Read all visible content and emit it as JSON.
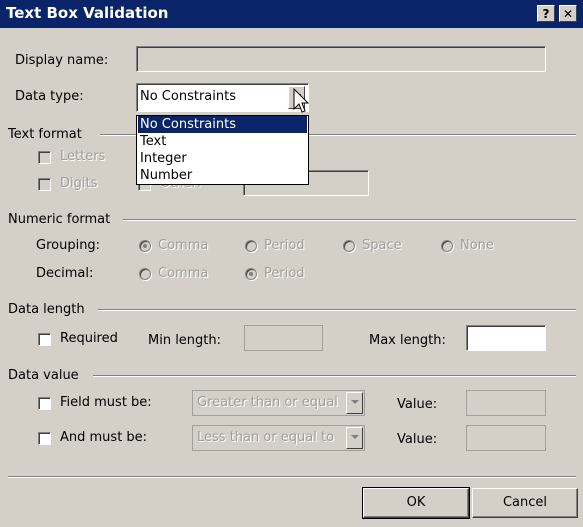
{
  "window": {
    "title": "Text Box Validation",
    "help_button": "?",
    "close_button": "✕",
    "colors": {
      "titlebar": "#0a246a",
      "face": "#d4d0c8",
      "selection": "#0a246a"
    }
  },
  "display_name": {
    "label": "Display name:",
    "value": ""
  },
  "data_type": {
    "label": "Data type:",
    "selected": "No Constraints",
    "options": [
      "No Constraints",
      "Text",
      "Integer",
      "Number"
    ]
  },
  "text_format": {
    "title": "Text format",
    "letters": "Letters",
    "digits": "Digits",
    "other": "Other:"
  },
  "numeric_format": {
    "title": "Numeric format",
    "grouping_label": "Grouping:",
    "grouping_options": [
      "Comma",
      "Period",
      "Space",
      "None"
    ],
    "decimal_label": "Decimal:",
    "decimal_options": [
      "Comma",
      "Period"
    ]
  },
  "data_length": {
    "title": "Data length",
    "required": "Required",
    "min_label": "Min length:",
    "max_label": "Max length:",
    "min_value": "",
    "max_value": ""
  },
  "data_value": {
    "title": "Data value",
    "field_must_be": "Field must be:",
    "field_condition": "Greater than or equal",
    "value_label_1": "Value:",
    "and_must_be": "And must be:",
    "and_condition": "Less than or equal to",
    "value_label_2": "Value:"
  },
  "buttons": {
    "ok": "OK",
    "cancel": "Cancel"
  }
}
